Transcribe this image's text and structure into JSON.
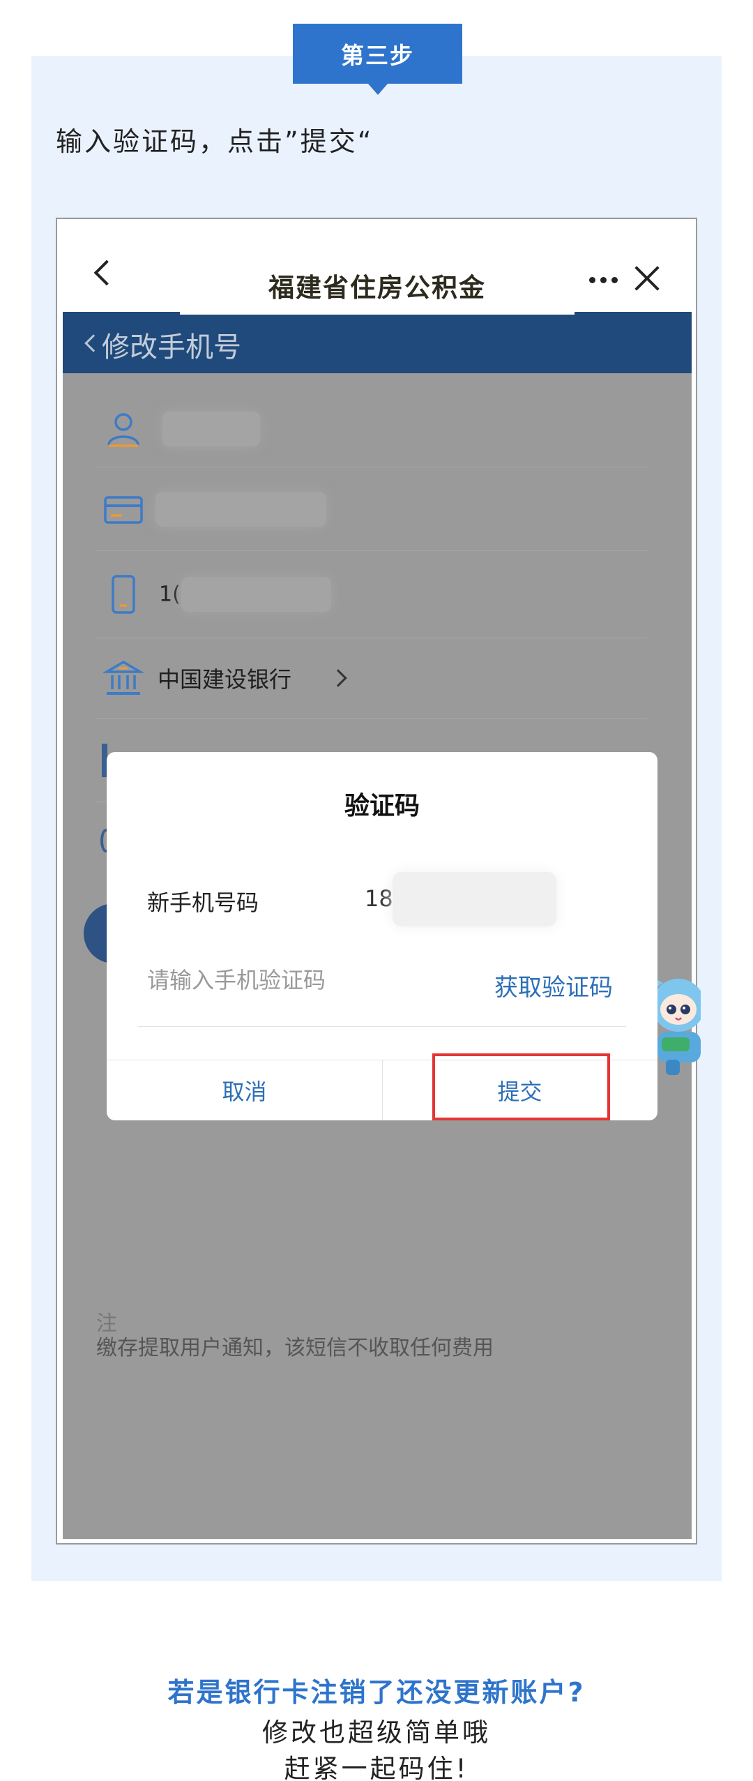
{
  "step_badge": "第三步",
  "instruction": "输入验证码，点击”提交“",
  "app": {
    "nav_title": "福建省住房公积金",
    "page_title": "修改手机号"
  },
  "form": {
    "phone_prefix": "1(",
    "bank": "中国建设银行",
    "notice_line2": "缴存提取用户通知，该短信不收取任何费用",
    "notice_line1_fragment": "注"
  },
  "dialog": {
    "title": "验证码",
    "phone_label": "新手机号码",
    "phone_value_visible": "186",
    "code_placeholder": "请输入手机验证码",
    "get_code": "获取验证码",
    "cancel": "取消",
    "submit": "提交"
  },
  "footer": {
    "question": "若是银行卡注销了还没更新账户?",
    "line1": "修改也超级简单哦",
    "line2": "赶紧一起码住!"
  },
  "colors": {
    "accent": "#2e74cc",
    "header": "#1f4a7b",
    "overlay": "#9a9a9a",
    "link": "#2c6fb6",
    "highlight": "#e43535",
    "panel": "#e9f2fd"
  }
}
